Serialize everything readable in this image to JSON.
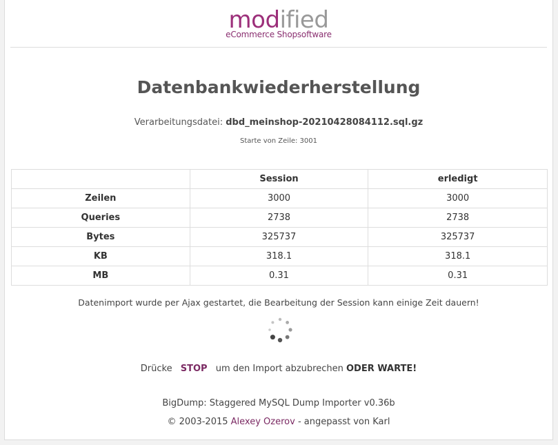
{
  "brand": {
    "logo_part1": "mod",
    "logo_part2": "ified",
    "tagline": "eCommerce Shopsoftware"
  },
  "page": {
    "title": "Datenbankwiederherstellung",
    "file_label": "Verarbeitungsdatei:",
    "file_name": "dbd_meinshop-20210428084112.sql.gz",
    "start_line": "Starte von Zeile: 3001"
  },
  "table": {
    "headers": [
      "",
      "Session",
      "erledigt"
    ],
    "rows": [
      {
        "label": "Zeilen",
        "session": "3000",
        "done": "3000"
      },
      {
        "label": "Queries",
        "session": "2738",
        "done": "2738"
      },
      {
        "label": "Bytes",
        "session": "325737",
        "done": "325737"
      },
      {
        "label": "KB",
        "session": "318.1",
        "done": "318.1"
      },
      {
        "label": "MB",
        "session": "0.31",
        "done": "0.31"
      }
    ]
  },
  "status": {
    "notice": "Datenimport wurde per Ajax gestartet, die Bearbeitung der Session kann einige Zeit dauern!",
    "spinner_icon": "loading-spinner-icon",
    "press_text": "Drücke",
    "stop_label": "STOP",
    "abort_text": "um den Import abzubrechen",
    "wait_text": "ODER WARTE!"
  },
  "footer": {
    "line1": "BigDump: Staggered MySQL Dump Importer v0.36b",
    "copyright": "© 2003-2015",
    "author": "Alexey Ozerov",
    "adapted": "- angepasst von Karl"
  },
  "colors": {
    "brand_purple": "#9c2f7a",
    "link": "#7b2a63",
    "border": "#dddddd"
  }
}
